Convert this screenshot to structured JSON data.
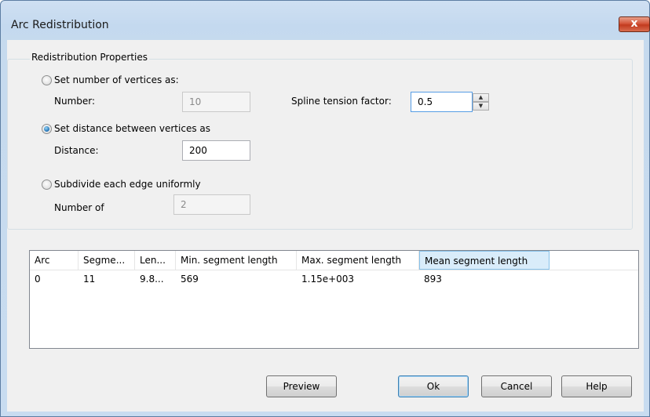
{
  "window": {
    "title": "Arc Redistribution",
    "close_glyph": "x"
  },
  "group": {
    "legend": "Redistribution Properties"
  },
  "options": {
    "vertices": {
      "label": "Set number of vertices as:",
      "field_label": "Number:",
      "value": "10",
      "checked": false
    },
    "distance": {
      "label": "Set distance between vertices as",
      "field_label": "Distance:",
      "value": "200",
      "checked": true
    },
    "subdivide": {
      "label": "Subdivide each edge uniformly",
      "field_label": "Number of",
      "value": "2",
      "checked": false
    }
  },
  "spline": {
    "label": "Spline tension factor:",
    "value": "0.5"
  },
  "table": {
    "columns": [
      "Arc",
      "Segme...",
      "Len...",
      "Min. segment length",
      "Max. segment length",
      "Mean segment length"
    ],
    "rows": [
      [
        "0",
        "11",
        "9.8...",
        "569",
        "1.15e+003",
        "893"
      ]
    ]
  },
  "buttons": {
    "preview": "Preview",
    "ok": "Ok",
    "cancel": "Cancel",
    "help": "Help"
  },
  "colors": {
    "accent": "#569de5",
    "selected_header": "#d9ecfa"
  }
}
